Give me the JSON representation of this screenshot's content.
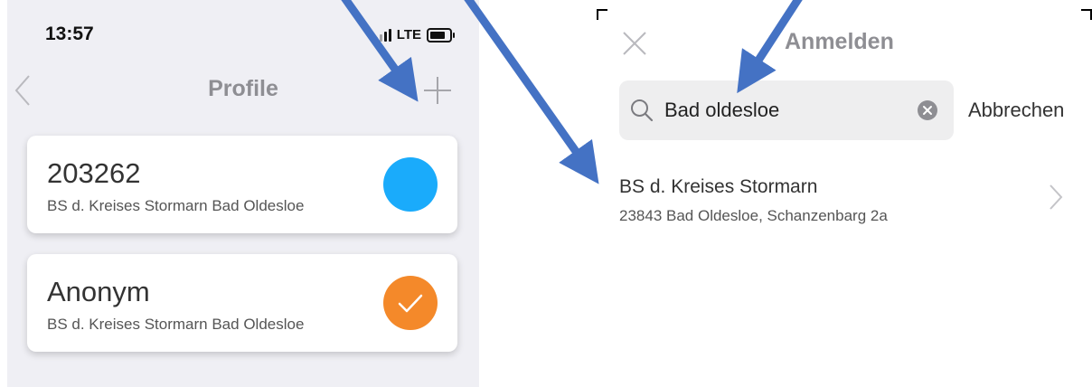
{
  "left_screen": {
    "status_bar": {
      "time": "13:57",
      "network": "LTE"
    },
    "nav": {
      "title": "Profile"
    },
    "profiles": [
      {
        "name": "203262",
        "subtitle": "BS d. Kreises Stormarn Bad Oldesloe",
        "status": "blue-dot",
        "color": "#1aabfb"
      },
      {
        "name": "Anonym",
        "subtitle": "BS d. Kreises Stormarn Bad Oldesloe",
        "status": "checkmark-selected",
        "color": "#f4892a"
      }
    ]
  },
  "right_screen": {
    "title": "Anmelden",
    "search": {
      "value": "Bad oldesloe"
    },
    "cancel_label": "Abbrechen",
    "results": [
      {
        "title": "BS d. Kreises Stormarn",
        "subtitle": "23843 Bad Oldesloe, Schanzenbarg 2a"
      }
    ]
  },
  "annotation_color": "#4472c4"
}
